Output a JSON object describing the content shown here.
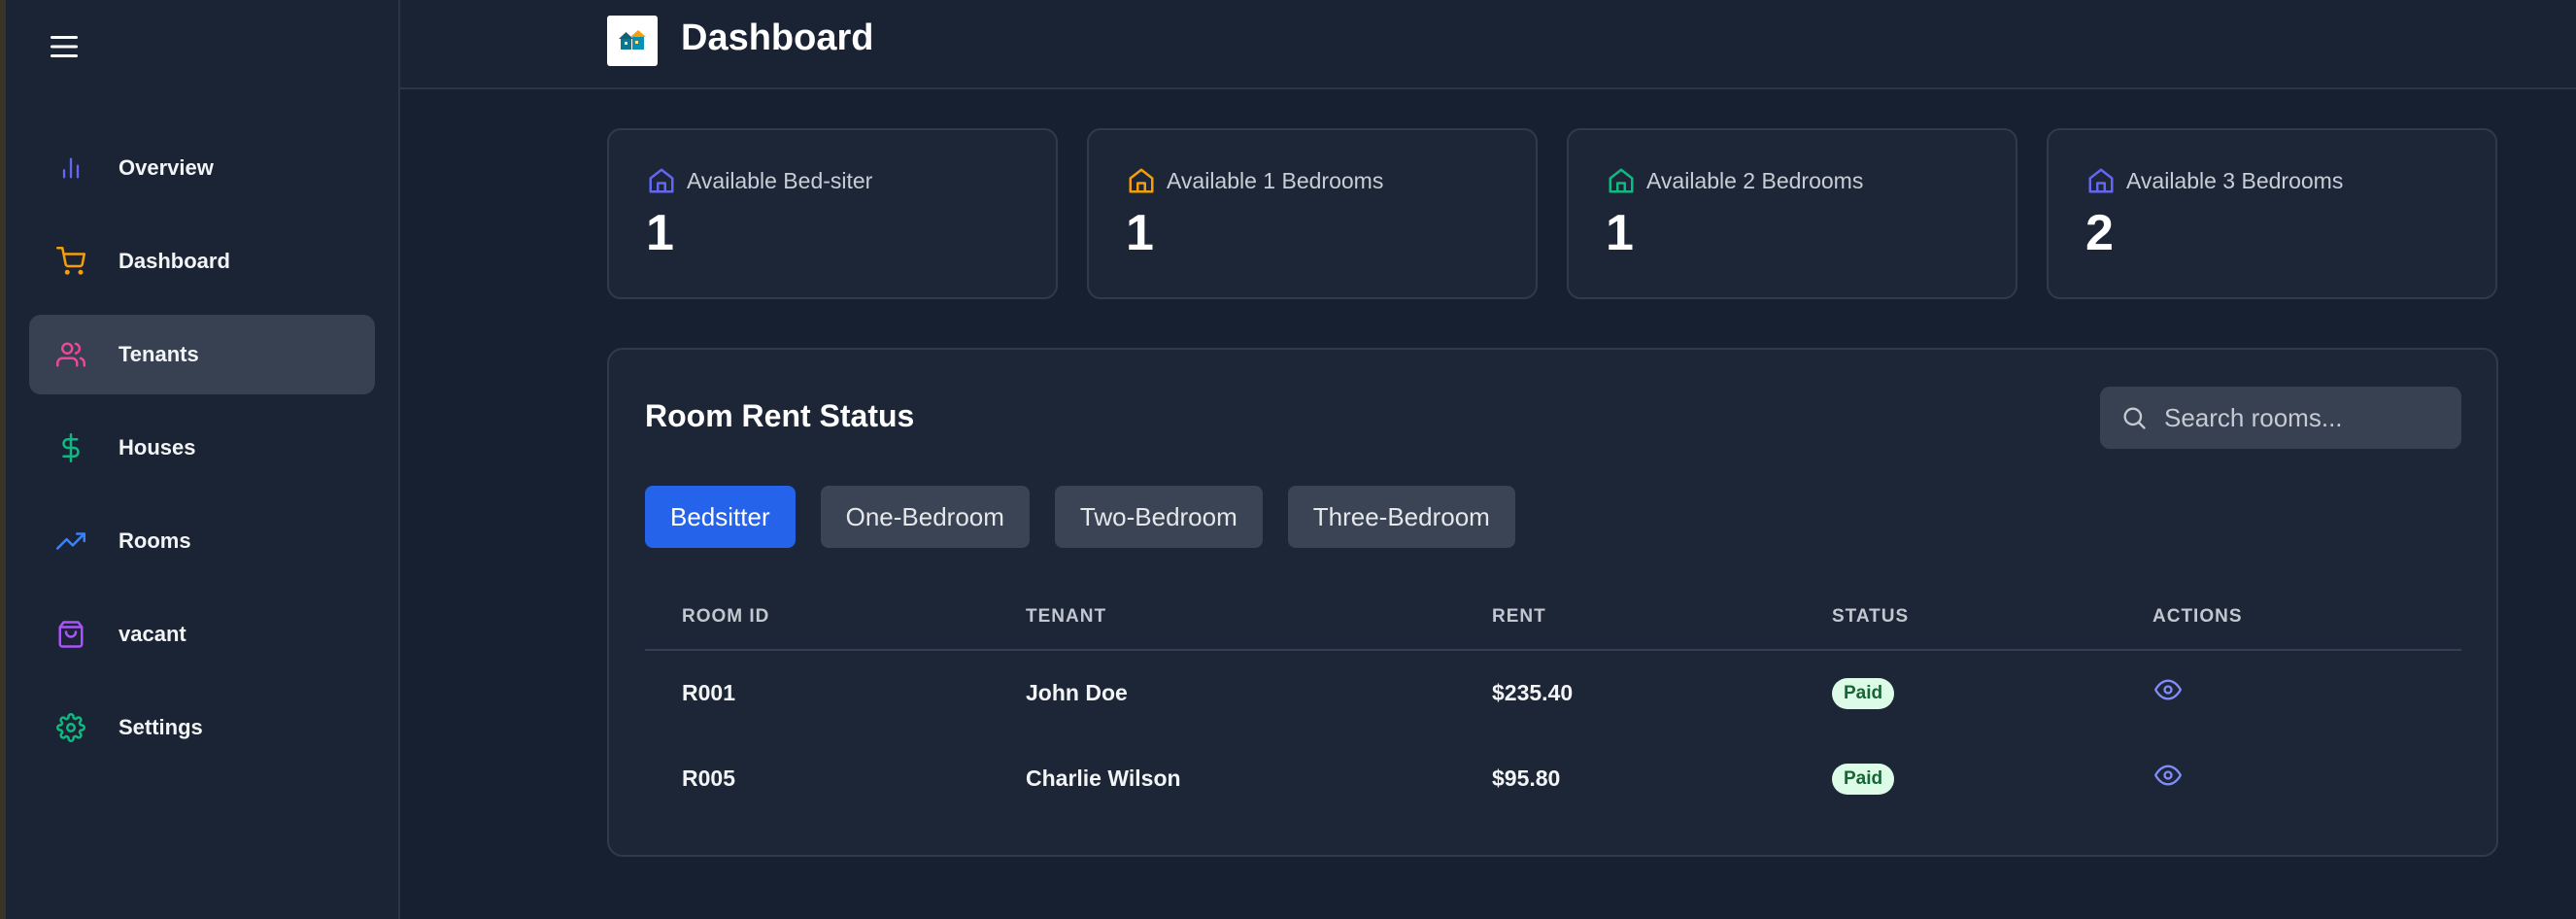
{
  "header": {
    "title": "Dashboard",
    "logo_icon": "house-logo-icon"
  },
  "sidebar": {
    "menu_icon": "hamburger-menu-icon",
    "items": [
      {
        "label": "Overview",
        "icon": "bar-chart-icon",
        "color": "#6366f1",
        "active": false
      },
      {
        "label": "Dashboard",
        "icon": "shopping-cart-icon",
        "color": "#f59e0b",
        "active": false
      },
      {
        "label": "Tenants",
        "icon": "users-icon",
        "color": "#ec4899",
        "active": true
      },
      {
        "label": "Houses",
        "icon": "dollar-sign-icon",
        "color": "#10b981",
        "active": false
      },
      {
        "label": "Rooms",
        "icon": "trending-up-icon",
        "color": "#3b82f6",
        "active": false
      },
      {
        "label": "vacant",
        "icon": "shopping-bag-icon",
        "color": "#a855f7",
        "active": false
      },
      {
        "label": "Settings",
        "icon": "gear-icon",
        "color": "#10b981",
        "active": false
      }
    ]
  },
  "stats": [
    {
      "label": "Available Bed-siter",
      "value": "1",
      "icon": "home-icon",
      "color": "#6366f1"
    },
    {
      "label": "Available 1 Bedrooms",
      "value": "1",
      "icon": "home-icon",
      "color": "#f59e0b"
    },
    {
      "label": "Available 2 Bedrooms",
      "value": "1",
      "icon": "home-icon",
      "color": "#10b981"
    },
    {
      "label": "Available 3 Bedrooms",
      "value": "2",
      "icon": "home-icon",
      "color": "#6366f1"
    }
  ],
  "rent_status": {
    "title": "Room Rent Status",
    "search": {
      "placeholder": "Search rooms...",
      "value": ""
    },
    "tabs": [
      {
        "label": "Bedsitter",
        "active": true
      },
      {
        "label": "One-Bedroom",
        "active": false
      },
      {
        "label": "Two-Bedroom",
        "active": false
      },
      {
        "label": "Three-Bedroom",
        "active": false
      }
    ],
    "columns": [
      "ROOM ID",
      "TENANT",
      "RENT",
      "STATUS",
      "ACTIONS"
    ],
    "rows": [
      {
        "room_id": "R001",
        "tenant": "John Doe",
        "rent": "$235.40",
        "status": "Paid"
      },
      {
        "room_id": "R005",
        "tenant": "Charlie Wilson",
        "rent": "$95.80",
        "status": "Paid"
      }
    ]
  },
  "colors": {
    "accent": "#2563eb",
    "paid_badge_bg": "#dcfce7",
    "paid_badge_text": "#166534",
    "view_icon": "#818cf8"
  }
}
